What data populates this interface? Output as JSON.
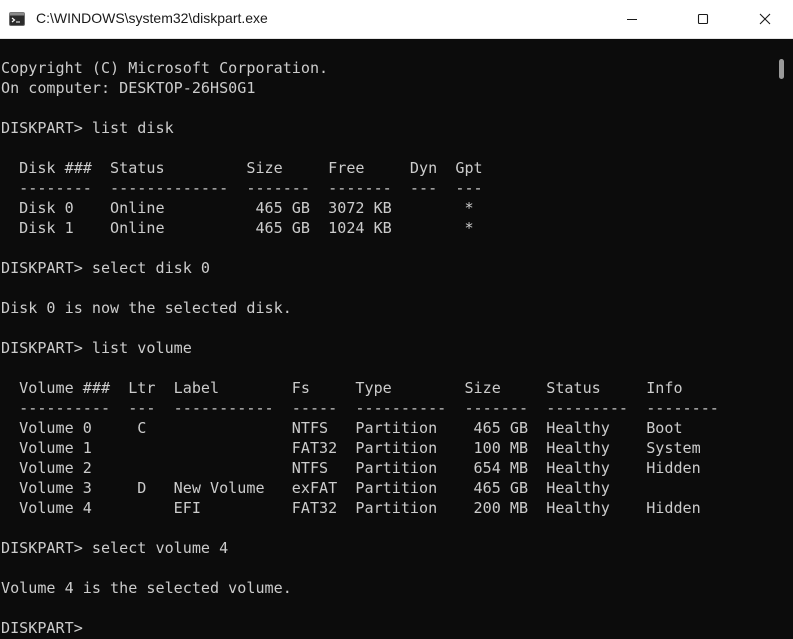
{
  "window": {
    "title": "C:\\WINDOWS\\system32\\diskpart.exe",
    "app_icon": "console-app-icon",
    "controls": [
      "minimize-icon",
      "maximize-icon",
      "close-icon"
    ]
  },
  "console": {
    "lines": [
      "Copyright (C) Microsoft Corporation.",
      "On computer: DESKTOP-26HS0G1",
      "",
      "DISKPART> list disk",
      "",
      "  Disk ###  Status         Size     Free     Dyn  Gpt",
      "  --------  -------------  -------  -------  ---  ---",
      "  Disk 0    Online          465 GB  3072 KB        *",
      "  Disk 1    Online          465 GB  1024 KB        *",
      "",
      "DISKPART> select disk 0",
      "",
      "Disk 0 is now the selected disk.",
      "",
      "DISKPART> list volume",
      "",
      "  Volume ###  Ltr  Label        Fs     Type        Size     Status     Info",
      "  ----------  ---  -----------  -----  ----------  -------  ---------  --------",
      "  Volume 0     C                NTFS   Partition    465 GB  Healthy    Boot",
      "  Volume 1                      FAT32  Partition    100 MB  Healthy    System",
      "  Volume 2                      NTFS   Partition    654 MB  Healthy    Hidden",
      "  Volume 3     D   New Volume   exFAT  Partition    465 GB  Healthy",
      "  Volume 4         EFI          FAT32  Partition    200 MB  Healthy    Hidden",
      "",
      "DISKPART> select volume 4",
      "",
      "Volume 4 is the selected volume.",
      "",
      "DISKPART> "
    ]
  }
}
